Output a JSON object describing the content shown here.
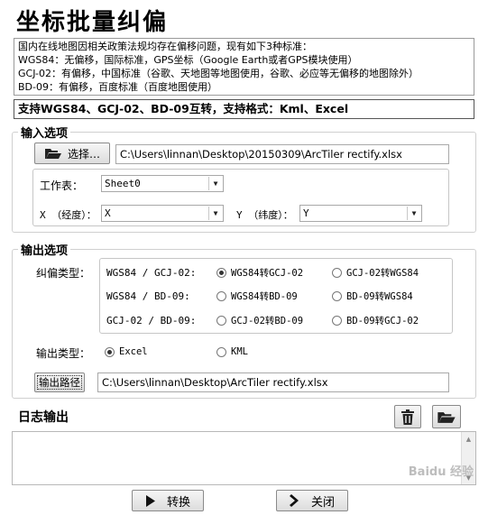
{
  "title": "坐标批量纠偏",
  "notice": [
    "国内在线地图因相关政策法规均存在偏移问题，现有如下3种标准：",
    "WGS84：无偏移，国际标准，GPS坐标（Google Earth或者GPS模块使用）",
    "GCJ-02：有偏移，中国标准（谷歌、天地图等地图使用，谷歌、必应等无偏移的地图除外）",
    "BD-09：有偏移，百度标准（百度地图使用）"
  ],
  "support_text": "支持WGS84、GCJ-02、BD-09互转，支持格式：Kml、Excel",
  "input": {
    "group_title": "输入选项",
    "select_label": "选择…",
    "file_path": "C:\\Users\\linnan\\Desktop\\20150309\\ArcTiler rectify.xlsx",
    "sheet_label": "工作表：",
    "sheet_value": "Sheet0",
    "x_label": "X （经度）：",
    "x_value": "X",
    "y_label": "Y （纬度）：",
    "y_value": "Y"
  },
  "output": {
    "group_title": "输出选项",
    "rectify_label": "纠偏类型：",
    "rows": [
      {
        "pair": "WGS84 / GCJ-02:",
        "opt1": "WGS84转GCJ-02",
        "opt2": "GCJ-02转WGS84"
      },
      {
        "pair": "WGS84 / BD-09:",
        "opt1": "WGS84转BD-09",
        "opt2": "BD-09转WGS84"
      },
      {
        "pair": "GCJ-02 / BD-09:",
        "opt1": "GCJ-02转BD-09",
        "opt2": "BD-09转GCJ-02"
      }
    ],
    "selected_rectify": "WGS84转GCJ-02",
    "type_label": "输出类型：",
    "type_excel": "Excel",
    "type_kml": "KML",
    "selected_type": "Excel",
    "path_button": "输出路径",
    "path_value": "C:\\Users\\linnan\\Desktop\\ArcTiler rectify.xlsx"
  },
  "log": {
    "title": "日志输出"
  },
  "buttons": {
    "convert": "转换",
    "close": "关闭"
  },
  "watermark": "Baidu 经验",
  "icons": {
    "folder": "folder-open-icon",
    "trash": "trash-icon",
    "arrow": "play-arrow-icon",
    "chevron": "chevron-right-icon"
  }
}
